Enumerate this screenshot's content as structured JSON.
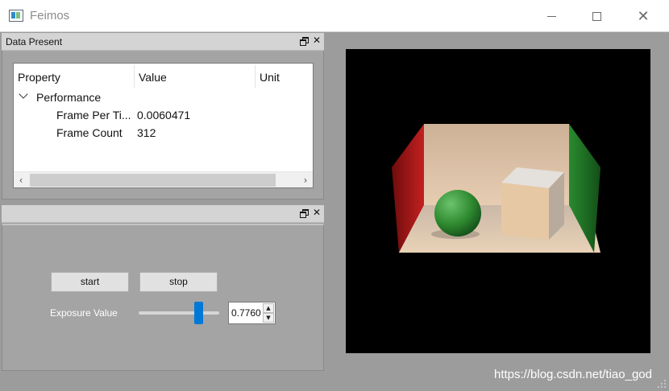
{
  "window": {
    "title": "Feimos",
    "icon": "app-window-icon"
  },
  "dock_data": {
    "title": "Data Present",
    "tree": {
      "columns": [
        "Property",
        "Value",
        "Unit"
      ],
      "group": "Performance",
      "rows": [
        {
          "property": "Frame Per Ti...",
          "value": "0.0060471",
          "unit": ""
        },
        {
          "property": "Frame Count",
          "value": "312",
          "unit": ""
        }
      ]
    }
  },
  "dock_controls": {
    "title": "",
    "start_label": "start",
    "stop_label": "stop",
    "exposure_label": "Exposure Value",
    "exposure_value": "0.7760",
    "slider_fraction": 0.74
  },
  "watermark": "https://blog.csdn.net/tiao_god",
  "colors": {
    "accent": "#0078d7",
    "background": "#9c9c9c",
    "viewport": "#000000",
    "wall_left": "#b01a1a",
    "wall_right": "#1f7a26",
    "sphere": "#3a9a3a",
    "box": "#e2c6a2"
  }
}
